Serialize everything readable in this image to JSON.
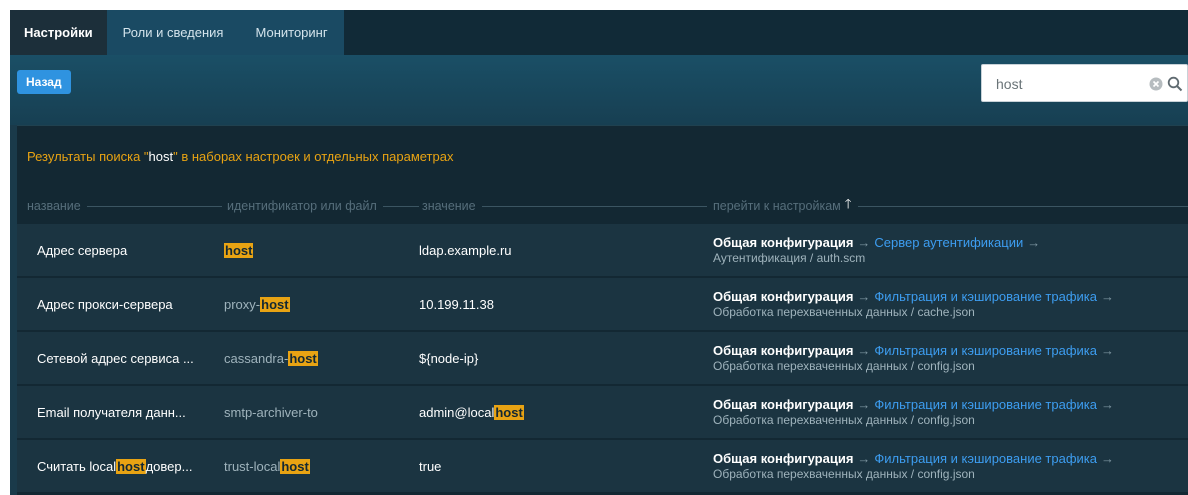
{
  "tabs": [
    {
      "label": "Настройки",
      "active": true
    },
    {
      "label": "Роли и сведения",
      "active": false
    },
    {
      "label": "Мониторинг",
      "active": false
    }
  ],
  "toolbar": {
    "back_label": "Назад"
  },
  "search": {
    "value": "host",
    "icon": "search-icon",
    "clear_icon": "clear-icon"
  },
  "results": {
    "title_prefix": "Результаты поиска \"",
    "query": "host",
    "title_suffix": "\" в наборах настроек и отдельных параметрах",
    "columns": {
      "name": "название",
      "id": "идентификатор или файл",
      "value": "значение",
      "nav": "перейти к настройкам"
    },
    "sort_icon": "arrow-up-icon",
    "rows": [
      {
        "name": [
          {
            "t": "Адрес сервера"
          }
        ],
        "id": [
          {
            "t": "host",
            "h": true
          }
        ],
        "value": [
          {
            "t": "ldap.example.ru"
          }
        ],
        "nav_root": "Общая конфигурация",
        "nav_link": "Сервер аутентификации",
        "nav_path": "Аутентификация / auth.scm"
      },
      {
        "name": [
          {
            "t": "Адрес прокси-сервера"
          }
        ],
        "id": [
          {
            "t": "proxy-"
          },
          {
            "t": "host",
            "h": true
          }
        ],
        "value": [
          {
            "t": "10.199.11.38"
          }
        ],
        "nav_root": "Общая конфигурация",
        "nav_link": "Фильтрация и кэширование трафика",
        "nav_path": "Обработка перехваченных данных / cache.json"
      },
      {
        "name": [
          {
            "t": "Сетевой адрес сервиса ..."
          }
        ],
        "id": [
          {
            "t": "cassandra-"
          },
          {
            "t": "host",
            "h": true
          }
        ],
        "value": [
          {
            "t": "${node-ip}"
          }
        ],
        "nav_root": "Общая конфигурация",
        "nav_link": "Фильтрация и кэширование трафика",
        "nav_path": "Обработка перехваченных данных / config.json"
      },
      {
        "name": [
          {
            "t": "Email получателя данн..."
          }
        ],
        "id": [
          {
            "t": "smtp-archiver-to"
          }
        ],
        "value": [
          {
            "t": "admin@local"
          },
          {
            "t": "host",
            "h": true
          }
        ],
        "nav_root": "Общая конфигурация",
        "nav_link": "Фильтрация и кэширование трафика",
        "nav_path": "Обработка перехваченных данных / config.json"
      },
      {
        "name": [
          {
            "t": "Считать local"
          },
          {
            "t": "host",
            "h": true
          },
          {
            "t": " довер..."
          }
        ],
        "id": [
          {
            "t": "trust-local"
          },
          {
            "t": "host",
            "h": true
          }
        ],
        "value": [
          {
            "t": "true"
          }
        ],
        "nav_root": "Общая конфигурация",
        "nav_link": "Фильтрация и кэширование трафика",
        "nav_path": "Обработка перехваченных данных / config.json"
      }
    ]
  },
  "colors": {
    "accent": "#2f93e0",
    "highlight": "#e8a313",
    "link": "#3d9df0"
  }
}
